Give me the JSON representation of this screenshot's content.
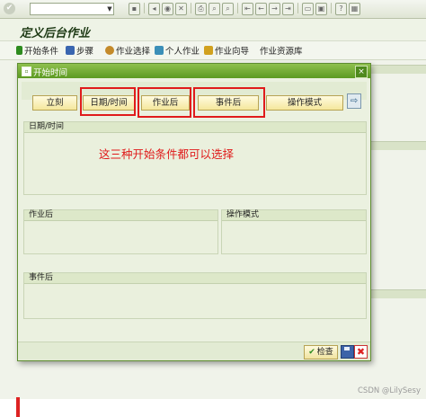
{
  "page_title": "定义后台作业",
  "app_toolbar": {
    "items": [
      {
        "label": "开始条件",
        "icon": "flag-icon"
      },
      {
        "label": "步骤",
        "icon": "steps-icon"
      },
      {
        "label": "作业选择",
        "icon": "user-select-icon"
      },
      {
        "label": "个人作业",
        "icon": "personal-job-icon"
      },
      {
        "label": "作业向导",
        "icon": "wizard-icon"
      },
      {
        "label": "作业资源库",
        "icon": ""
      }
    ]
  },
  "dialog": {
    "title": "开始时间",
    "close": "×",
    "buttons": {
      "immediate": "立刻",
      "datetime": "日期/时间",
      "after_job": "作业后",
      "after_event": "事件后",
      "op_mode": "操作模式",
      "next": "⇨"
    },
    "panels": {
      "datetime": "日期/时间",
      "after_job": "作业后",
      "op_mode": "操作模式",
      "after_event": "事件后"
    },
    "annotation": "这三种开始条件都可以选择",
    "footer": {
      "check": "检查"
    }
  },
  "watermark": "CSDN @LilySesy",
  "colors": {
    "dialog_header": "#5c9a22",
    "highlight": "#e01b1b",
    "button_face": "#f5e79c"
  }
}
